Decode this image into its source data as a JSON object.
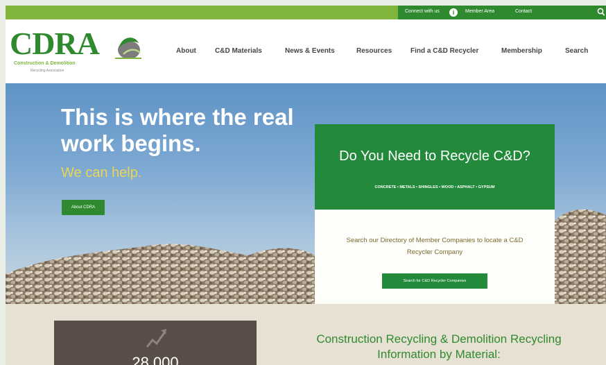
{
  "topbar": {
    "connect_label": "Connect with us",
    "info_icon": "i",
    "member_area_label": "Member Area",
    "contact_label": "Contact",
    "search_icon": "search-icon"
  },
  "logo": {
    "text": "CDRA",
    "subtitle": "Construction & Demolition",
    "subtitle2": "Recycling Association"
  },
  "nav": {
    "items": [
      {
        "label": "About"
      },
      {
        "label": "C&D Materials"
      },
      {
        "label": "News & Events"
      },
      {
        "label": "Resources"
      },
      {
        "label": "Find a C&D Recycler"
      },
      {
        "label": "Membership"
      },
      {
        "label": "Search"
      }
    ]
  },
  "hero": {
    "title": "This is where the real work begins.",
    "subtitle": "We can help.",
    "button_label": "About CDRA"
  },
  "recycle_card": {
    "title": "Do You Need to Recycle C&D?",
    "materials": "CONCRETE • METALS • SHINGLES • WOOD • ASPHALT • GYPSUM",
    "description": "Search our Directory of Member Companies to locate a C&D Recycler Company",
    "button_label": "Search for C&D Recycler Companies"
  },
  "stats": {
    "number": "28,000",
    "icon": "trend-up-icon"
  },
  "lower": {
    "heading": "Construction Recycling & Demolition Recycling Information by Material:"
  },
  "colors": {
    "primary_green": "#2f8a2f",
    "lime_green": "#7fb53c",
    "card_green": "#238a3c",
    "accent_yellow": "#e8d657",
    "stat_box": "#594e47"
  }
}
